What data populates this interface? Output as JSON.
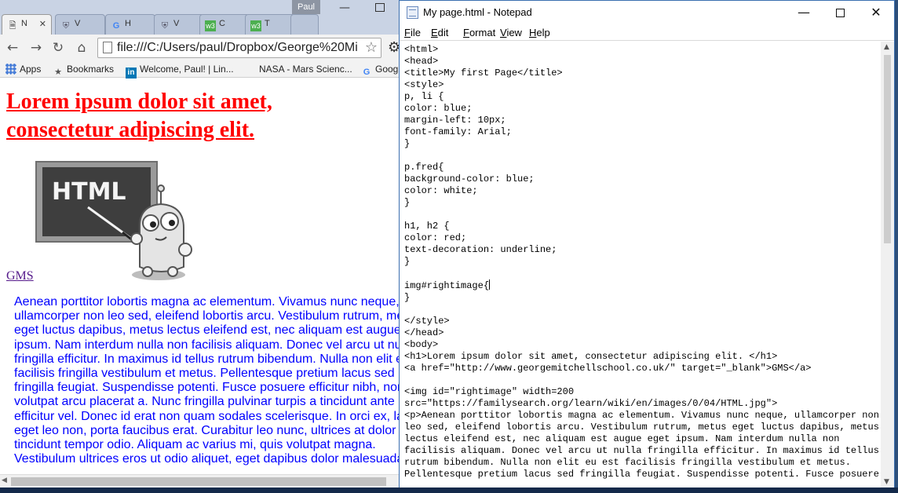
{
  "browser": {
    "user_chip": "Paul",
    "tabs": [
      {
        "icon": "page-icon",
        "label": "N"
      },
      {
        "icon": "shield-icon",
        "label": "V"
      },
      {
        "icon": "google-icon",
        "label": "H"
      },
      {
        "icon": "shield-icon",
        "label": "V"
      },
      {
        "icon": "w3-icon",
        "label": "C"
      },
      {
        "icon": "w3-icon",
        "label": "T"
      }
    ],
    "address": "file:///C:/Users/paul/Dropbox/George%20Mi",
    "bookmarks": [
      {
        "icon": "apps-icon",
        "label": "Apps"
      },
      {
        "icon": "star-icon",
        "label": "Bookmarks"
      },
      {
        "icon": "linkedin-icon",
        "label": "Welcome, Paul! | Lin..."
      },
      {
        "icon": "nasa-icon",
        "label": "NASA - Mars Scienc..."
      },
      {
        "icon": "google-icon",
        "label": "Goog"
      }
    ],
    "page": {
      "heading": "Lorem ipsum dolor sit amet, consectetur adipiscing elit.",
      "image_caption": "HTML",
      "link": "GMS",
      "paragraph": "Aenean porttitor lobortis magna ac elementum. Vivamus nunc neque, ullamcorper non leo sed, eleifend lobortis arcu. Vestibulum rutrum, metus eget luctus dapibus, metus lectus eleifend est, nec aliquam est augue eget ipsum. Nam interdum nulla non facilisis aliquam. Donec vel arcu ut nulla fringilla efficitur. In maximus id tellus rutrum bibendum. Nulla non elit eu est facilisis fringilla vestibulum et metus. Pellentesque pretium lacus sed fringilla feugiat. Suspendisse potenti. Fusce posuere efficitur nibh, non volutpat arcu placerat a. Nunc fringilla pulvinar turpis a tincidunt ante efficitur vel. Donec id erat non quam sodales scelerisque. In orci ex, lacinia eget leo non, porta faucibus erat. Curabitur leo nunc, ultrices at dolor eget, tincidunt tempor odio. Aliquam ac varius mi, quis volutpat magna. Vestibulum ultrices eros ut odio aliquet, eget dapibus dolor malesuada."
    }
  },
  "notepad": {
    "title": "My page.html - Notepad",
    "menus": [
      {
        "key": "F",
        "rest": "ile"
      },
      {
        "key": "E",
        "rest": "dit"
      },
      {
        "key": "F",
        "rest": "ormat"
      },
      {
        "key": "V",
        "rest": "iew"
      },
      {
        "key": "H",
        "rest": "elp"
      }
    ],
    "text_before_caret": "<html>\n<head>\n<title>My first Page</title>\n<style>\np, li {\ncolor: blue;\nmargin-left: 10px;\nfont-family: Arial;\n}\n\np.fred{\nbackground-color: blue;\ncolor: white;\n}\n\nh1, h2 {\ncolor: red;\ntext-decoration: underline;\n}\n\nimg#rightimage{",
    "text_after_caret": "\n}\n\n</style>\n</head>\n<body>\n<h1>Lorem ipsum dolor sit amet, consectetur adipiscing elit. </h1>\n<a href=\"http://www.georgemitchellschool.co.uk/\" target=\"_blank\">GMS</a>\n\n<img id=\"rightimage\" width=200\nsrc=\"https://familysearch.org/learn/wiki/en/images/0/04/HTML.jpg\">\n<p>Aenean porttitor lobortis magna ac elementum. Vivamus nunc neque, ullamcorper non\nleo sed, eleifend lobortis arcu. Vestibulum rutrum, metus eget luctus dapibus, metus\nlectus eleifend est, nec aliquam est augue eget ipsum. Nam interdum nulla non\nfacilisis aliquam. Donec vel arcu ut nulla fringilla efficitur. In maximus id tellus\nrutrum bibendum. Nulla non elit eu est facilisis fringilla vestibulum et metus.\nPellentesque pretium lacus sed fringilla feugiat. Suspendisse potenti. Fusce posuere"
  },
  "colors": {
    "heading_red": "#ff0000",
    "paragraph_blue": "#0000ff",
    "link_visited": "#551a8b"
  }
}
